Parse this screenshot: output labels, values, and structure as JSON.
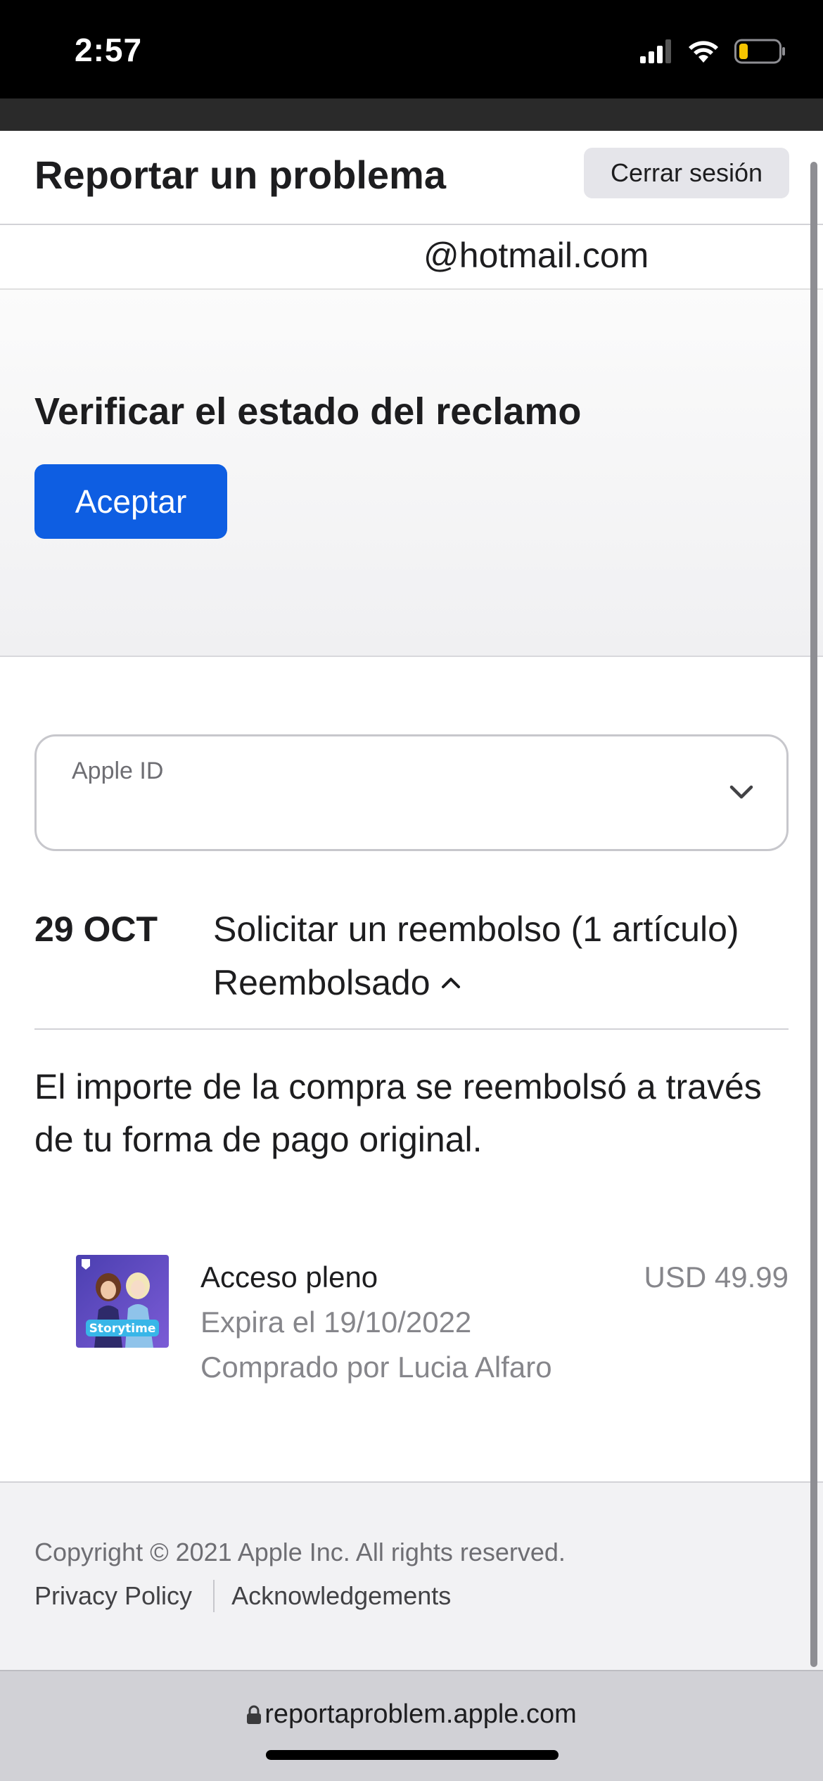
{
  "status_bar": {
    "time": "2:57",
    "battery_color": "#f5c400"
  },
  "header": {
    "title": "Reportar un problema",
    "signout_label": "Cerrar sesión"
  },
  "account": {
    "email": "@hotmail.com"
  },
  "claim": {
    "title": "Verificar el estado del reclamo",
    "accept_label": "Aceptar",
    "accent_color": "#0e5ee2"
  },
  "apple_id_select": {
    "label": "Apple ID",
    "value": ""
  },
  "refund": {
    "date": "29 OCT",
    "title": "Solicitar un reembolso (1 artículo)",
    "status": "Reembolsado",
    "note": "El importe de la compra se reembolsó a través de tu forma de pago original."
  },
  "item": {
    "icon": "storytime-app-icon",
    "name": "Acceso pleno",
    "price": "USD 49.99",
    "expiry": "Expira el 19/10/2022",
    "buyer": "Comprado por Lucia Alfaro"
  },
  "footer": {
    "copyright": "Copyright © 2021 Apple Inc. All rights reserved.",
    "links": [
      "Privacy Policy",
      "Acknowledgements"
    ]
  },
  "browser": {
    "url": "reportaproblem.apple.com"
  }
}
